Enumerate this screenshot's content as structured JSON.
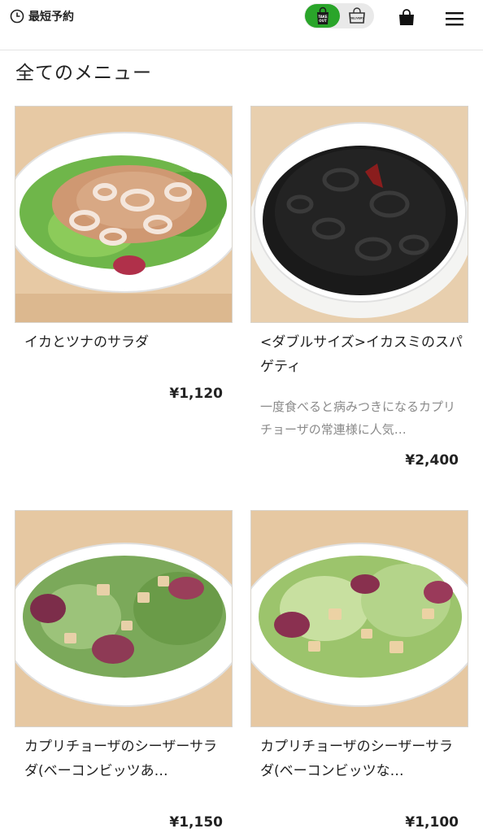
{
  "header": {
    "reserve_label": "最短予約",
    "takeout_label_top": "TAKE",
    "takeout_label_bottom": "OUT",
    "delivery_label": "DELIVERY",
    "accent_color": "#2aa52a"
  },
  "page": {
    "section_title": "全てのメニュー"
  },
  "menu_items": [
    {
      "name": "イカとツナのサラダ",
      "description": "",
      "price": "¥1,120",
      "image": "squid-tuna-salad"
    },
    {
      "name": "<ダブルサイズ>イカスミのスパゲティ",
      "description": "一度食べると病みつきになるカプリチョーザの常連様に人気…",
      "price": "¥2,400",
      "image": "squid-ink-spaghetti"
    },
    {
      "name": "カプリチョーザのシーザーサラダ(ベーコンビッツあ…",
      "description": "",
      "price": "¥1,150",
      "image": "caesar-salad-bacon"
    },
    {
      "name": "カプリチョーザのシーザーサラダ(ベーコンビッツな…",
      "description": "",
      "price": "¥1,100",
      "image": "caesar-salad-no-bacon"
    }
  ]
}
